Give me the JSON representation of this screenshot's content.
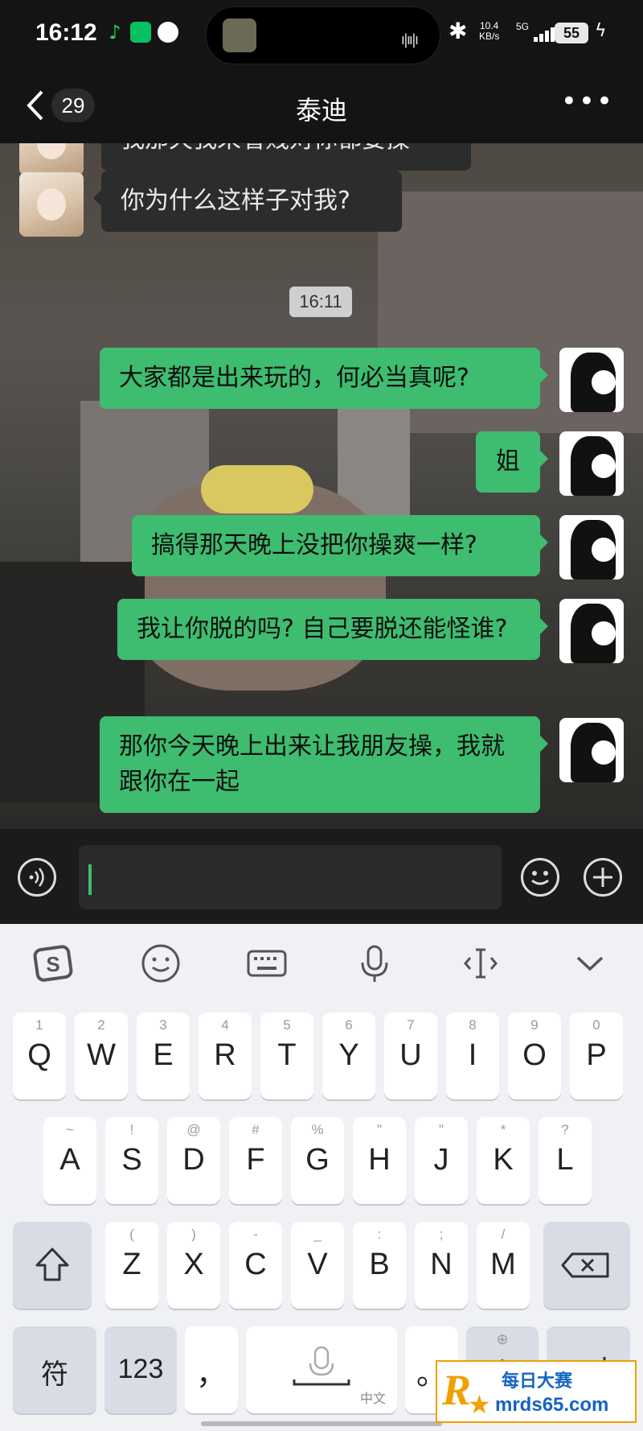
{
  "status_bar": {
    "time": "16:12",
    "net_speed_value": "10.4",
    "net_speed_unit": "KB/s",
    "network": "5G",
    "battery": "55"
  },
  "nav": {
    "back_count": "29",
    "title": "泰迪"
  },
  "messages": [
    {
      "side": "in",
      "text": "我那天我来看贱对你都要操"
    },
    {
      "side": "in",
      "text": "你为什么这样子对我?"
    },
    {
      "side": "out",
      "text": "大家都是出来玩的，何必当真呢?"
    },
    {
      "side": "out",
      "text": "姐"
    },
    {
      "side": "out",
      "text": "搞得那天晚上没把你操爽一样?"
    },
    {
      "side": "out",
      "text": "我让你脱的吗? 自己要脱还能怪谁?"
    },
    {
      "side": "out",
      "text": "那你今天晚上出来让我朋友操，我就跟你在一起"
    }
  ],
  "timestamp": "16:11",
  "keyboard": {
    "row1": [
      {
        "main": "Q",
        "sub": "1"
      },
      {
        "main": "W",
        "sub": "2"
      },
      {
        "main": "E",
        "sub": "3"
      },
      {
        "main": "R",
        "sub": "4"
      },
      {
        "main": "T",
        "sub": "5"
      },
      {
        "main": "Y",
        "sub": "6"
      },
      {
        "main": "U",
        "sub": "7"
      },
      {
        "main": "I",
        "sub": "8"
      },
      {
        "main": "O",
        "sub": "9"
      },
      {
        "main": "P",
        "sub": "0"
      }
    ],
    "row2": [
      {
        "main": "A",
        "sub": "~"
      },
      {
        "main": "S",
        "sub": "!"
      },
      {
        "main": "D",
        "sub": "@"
      },
      {
        "main": "F",
        "sub": "#"
      },
      {
        "main": "G",
        "sub": "%"
      },
      {
        "main": "H",
        "sub": "\""
      },
      {
        "main": "J",
        "sub": "\""
      },
      {
        "main": "K",
        "sub": "*"
      },
      {
        "main": "L",
        "sub": "?"
      }
    ],
    "row3": [
      {
        "main": "Z",
        "sub": "("
      },
      {
        "main": "X",
        "sub": ")"
      },
      {
        "main": "C",
        "sub": "-"
      },
      {
        "main": "V",
        "sub": "_"
      },
      {
        "main": "B",
        "sub": ":"
      },
      {
        "main": "N",
        "sub": ";"
      },
      {
        "main": "M",
        "sub": "/"
      }
    ],
    "symbols_key": "符",
    "numbers_key": "123",
    "comma_key": "，",
    "space_key_hint": "中文",
    "period_key": "。",
    "lang_key": "中"
  },
  "watermark": {
    "logo_letter": "R",
    "line1": "每日大赛",
    "line2": "mrds65.com"
  }
}
